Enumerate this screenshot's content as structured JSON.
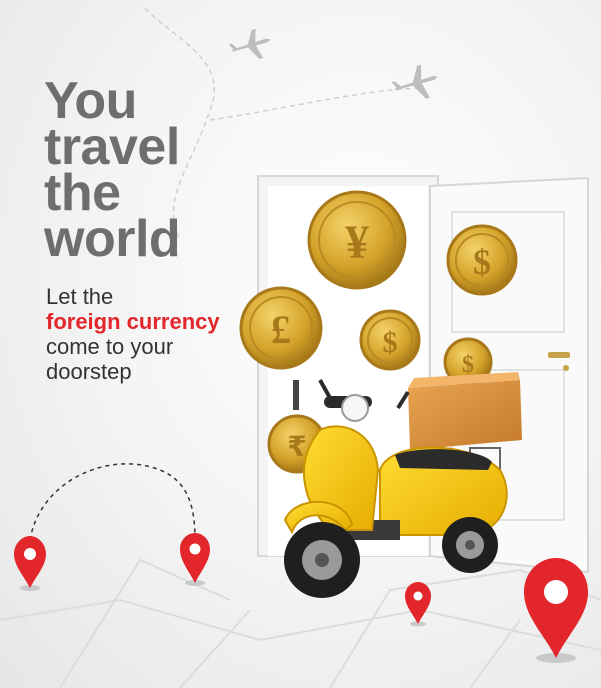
{
  "headline": {
    "line1": "You",
    "line2": "travel",
    "line3": "the",
    "line4": "world"
  },
  "subtext": {
    "line1": "Let the",
    "line2": "foreign currency",
    "line3": "come to your",
    "line4": "doorstep"
  },
  "colors": {
    "headline": "#6e6e6e",
    "accent": "#e3262b",
    "scooter": "#f5c518",
    "coin": "#d4a32a",
    "box": "#d9903a",
    "pin": "#e3262b"
  },
  "icons": [
    "airplane-icon",
    "yen-coin-icon",
    "dollar-coin-icon",
    "pound-coin-icon",
    "rupee-coin-icon",
    "location-pin-icon",
    "scooter-icon",
    "delivery-box-icon",
    "door-icon"
  ]
}
